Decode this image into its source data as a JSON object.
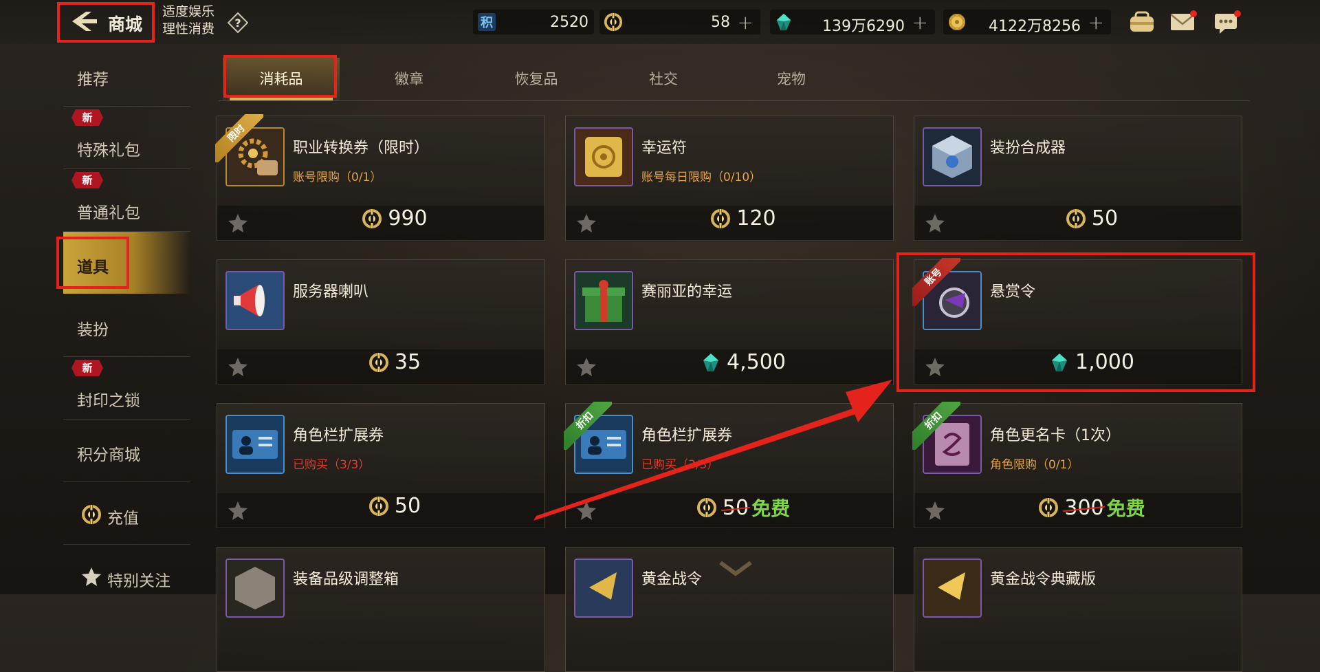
{
  "header": {
    "title": "商城",
    "moderation_line1": "适度娱乐",
    "moderation_line2": "理性消费",
    "currencies": [
      {
        "icon": "points-icon",
        "glyph": "积",
        "value": "2520",
        "has_plus": false
      },
      {
        "icon": "coupon-icon",
        "value": "58",
        "has_plus": true
      },
      {
        "icon": "gem-icon",
        "value": "139万6290",
        "has_plus": true
      },
      {
        "icon": "gold-coin-icon",
        "value": "4122万8256",
        "has_plus": true
      }
    ],
    "plus": "+"
  },
  "sidebar": {
    "new_badge": "新",
    "items": [
      {
        "label": "推荐",
        "new": false
      },
      {
        "label": "特殊礼包",
        "new": true
      },
      {
        "label": "普通礼包",
        "new": true
      },
      {
        "label": "道具",
        "new": false,
        "active": true
      },
      {
        "label": "装扮",
        "new": false
      },
      {
        "label": "封印之锁",
        "new": true
      },
      {
        "label": "积分商城",
        "new": false
      },
      {
        "label": "充值",
        "new": false
      },
      {
        "label": "特别关注",
        "new": false
      }
    ]
  },
  "tabs": [
    "消耗品",
    "徽章",
    "恢复品",
    "社交",
    "宠物"
  ],
  "active_tab": "消耗品",
  "ribbons": {
    "limited": "限时",
    "discount": "折扣",
    "account": "账号"
  },
  "products": [
    {
      "name": "职业转换券（限时）",
      "sub": "账号限购（0/1）",
      "currency": "coupon",
      "price": "990"
    },
    {
      "name": "幸运符",
      "sub": "账号每日限购（0/10）",
      "currency": "coupon",
      "price": "120"
    },
    {
      "name": "装扮合成器",
      "sub": "",
      "currency": "coupon",
      "price": "50"
    },
    {
      "name": "服务器喇叭",
      "sub": "",
      "currency": "coupon",
      "price": "35"
    },
    {
      "name": "赛丽亚的幸运",
      "sub": "",
      "currency": "gem",
      "price": "4,500"
    },
    {
      "name": "悬赏令",
      "sub": "",
      "currency": "gem",
      "price": "1,000"
    },
    {
      "name": "角色栏扩展券",
      "sub": "已购买（3/3）",
      "currency": "coupon",
      "price": "50"
    },
    {
      "name": "角色栏扩展券",
      "sub": "已购买（3/3）",
      "currency": "coupon",
      "old_price": "50",
      "free": "免费"
    },
    {
      "name": "角色更名卡（1次）",
      "sub": "角色限购（0/1）",
      "currency": "coupon",
      "old_price": "300",
      "free": "免费"
    },
    {
      "name": "装备品级调整箱",
      "sub": "",
      "currency": "coupon",
      "price": ""
    },
    {
      "name": "黄金战令",
      "sub": "",
      "currency": "coupon",
      "price": ""
    },
    {
      "name": "黄金战令典藏版",
      "sub": "",
      "currency": "coupon",
      "price": ""
    }
  ],
  "colors": {
    "accent_gold": "#c9a43a",
    "highlight_red": "#e4231d",
    "free_green": "#7fd44a",
    "limit_orange": "#e6a440",
    "sold_red": "#e33a2a"
  }
}
